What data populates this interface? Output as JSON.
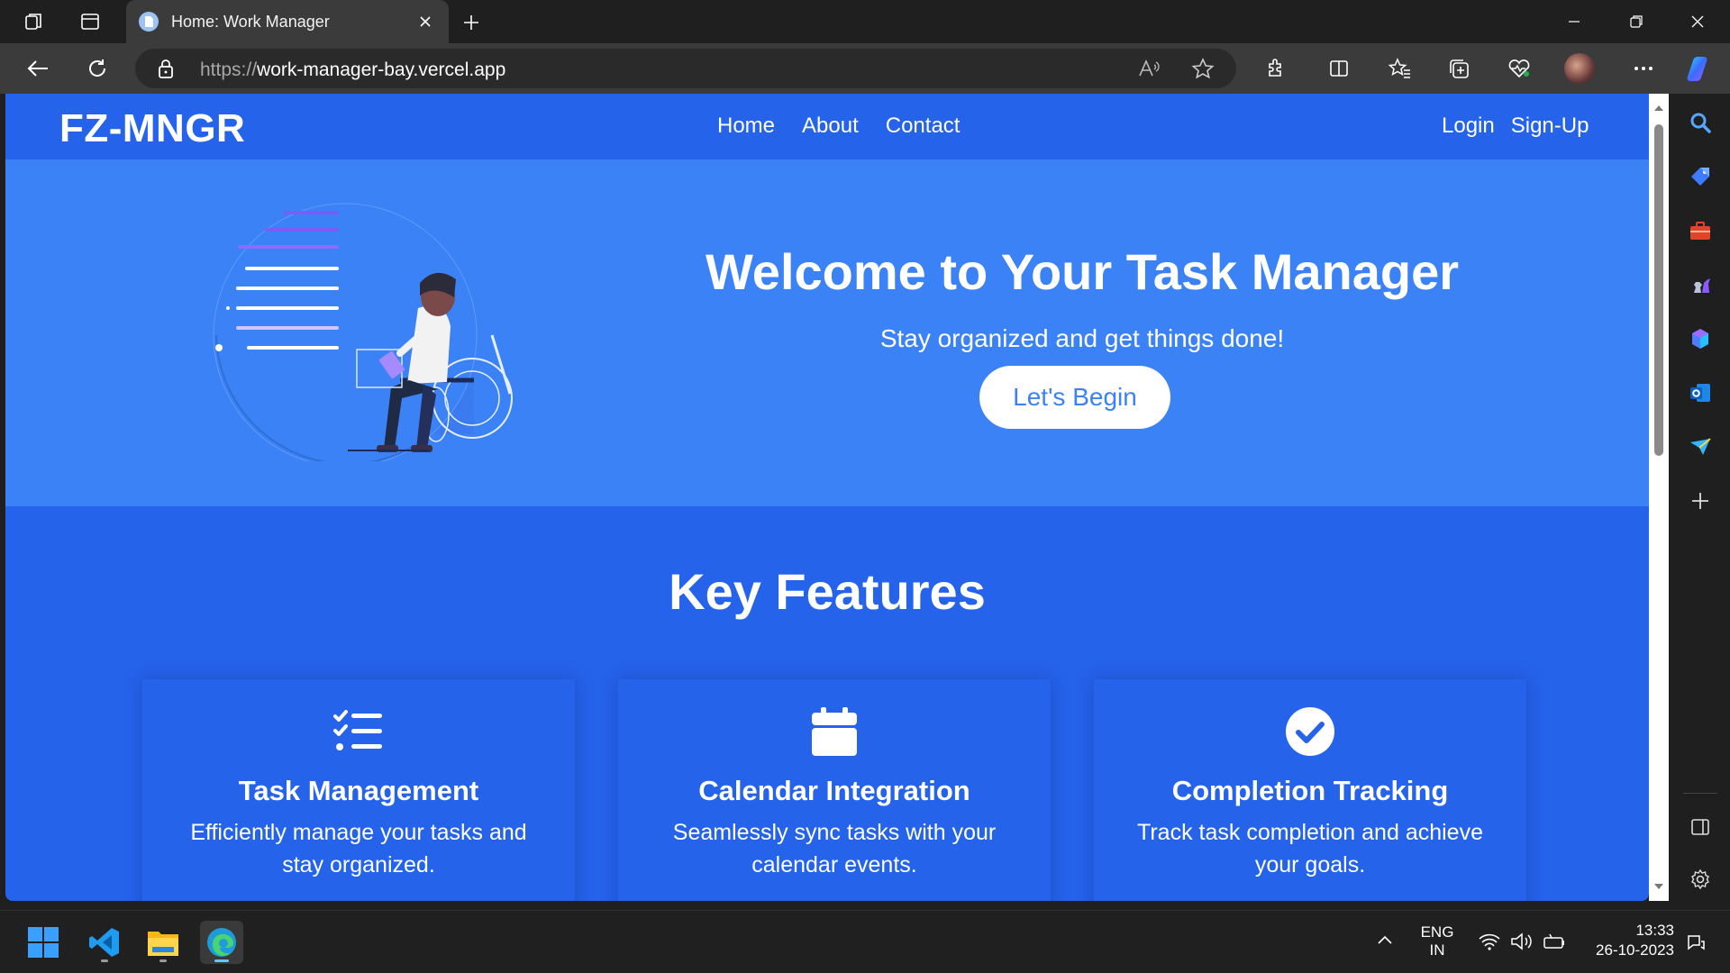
{
  "browser": {
    "tab_title": "Home: Work Manager",
    "url_protocol": "https://",
    "url_host": "work-manager-bay.vercel.app"
  },
  "site": {
    "brand": "FZ-MNGR",
    "nav_center": [
      "Home",
      "About",
      "Contact"
    ],
    "nav_right": [
      "Login",
      "Sign-Up"
    ],
    "hero": {
      "title": "Welcome to Your Task Manager",
      "subtitle": "Stay organized and get things done!",
      "cta": "Let's Begin"
    },
    "features_title": "Key Features",
    "features": [
      {
        "icon": "list-check-icon",
        "title": "Task Management",
        "desc": "Efficiently manage your tasks and stay organized."
      },
      {
        "icon": "calendar-icon",
        "title": "Calendar Integration",
        "desc": "Seamlessly sync tasks with your calendar events."
      },
      {
        "icon": "check-circle-icon",
        "title": "Completion Tracking",
        "desc": "Track task completion and achieve your goals."
      }
    ],
    "colors": {
      "primary": "#2563eb",
      "hero": "#3b82f6",
      "text": "#ffffff"
    }
  },
  "taskbar": {
    "lang_line1": "ENG",
    "lang_line2": "IN",
    "time": "13:33",
    "date": "26-10-2023"
  }
}
